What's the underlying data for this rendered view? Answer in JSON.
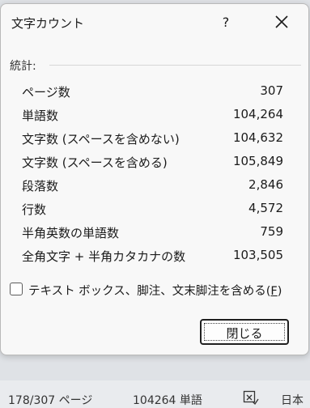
{
  "dialog": {
    "title": "文字カウント",
    "help": "?",
    "stats_header": "統計:",
    "stats": [
      {
        "label": "ページ数",
        "value": "307"
      },
      {
        "label": "単語数",
        "value": "104,264"
      },
      {
        "label": "文字数 (スペースを含めない)",
        "value": "104,632"
      },
      {
        "label": "文字数 (スペースを含める)",
        "value": "105,849"
      },
      {
        "label": "段落数",
        "value": "2,846"
      },
      {
        "label": "行数",
        "value": "4,572"
      },
      {
        "label": "半角英数の単語数",
        "value": "759"
      },
      {
        "label": "全角文字 + 半角カタカナの数",
        "value": "103,505"
      }
    ],
    "checkbox_label": "テキスト ボックス、脚注、文末脚注を含める(",
    "checkbox_accel": "F",
    "checkbox_close": ")",
    "checkbox_checked": false,
    "close_button": "閉じる"
  },
  "statusbar": {
    "page": "178/307 ページ",
    "words": "104264 単語",
    "language": "日本"
  }
}
